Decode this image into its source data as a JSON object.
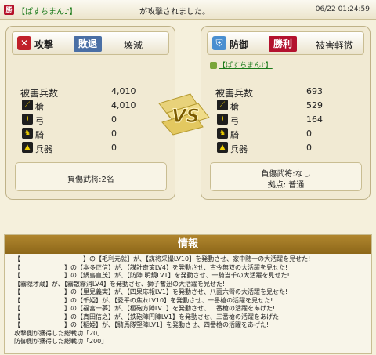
{
  "topbar": {
    "badge": "勝",
    "attacker": "【ぱすちまん♪】",
    "message": "が攻撃されました。",
    "timestamp": "06/22 01:24:59"
  },
  "attacker_panel": {
    "role": "攻撃",
    "result": "敗退",
    "status": "壊滅",
    "total_label": "被害兵数",
    "total_value": "4,010",
    "units": [
      {
        "label": "槍",
        "value": "4,010",
        "icon": "spear-icon"
      },
      {
        "label": "弓",
        "value": "0",
        "icon": "bow-icon"
      },
      {
        "label": "騎",
        "value": "0",
        "icon": "horse-icon"
      },
      {
        "label": "兵器",
        "value": "0",
        "icon": "siege-icon"
      }
    ],
    "footer_line1": "負傷武将:2名"
  },
  "defender_panel": {
    "role": "防御",
    "result": "勝利",
    "status": "被害軽微",
    "hero": "【ぱすちまん♪】",
    "total_label": "被害兵数",
    "total_value": "693",
    "units": [
      {
        "label": "槍",
        "value": "529",
        "icon": "spear-icon"
      },
      {
        "label": "弓",
        "value": "164",
        "icon": "bow-icon"
      },
      {
        "label": "騎",
        "value": "0",
        "icon": "horse-icon"
      },
      {
        "label": "兵器",
        "value": "0",
        "icon": "siege-icon"
      }
    ],
    "footer_line1": "負傷武将:なし",
    "footer_line2": "拠点: 普通"
  },
  "vs_label": "VS",
  "info": {
    "title": "情報",
    "lines": [
      "【　　　　　　　　　　】の【毛利元就】が、【謀将采撮LV10】を発動させ、家中随一の大活躍を見せた!",
      "【　　　　　　　】の【本多正信】が、【謀計奇策LV4】を発動させ、古今無双の大活躍を見せた!",
      "【　　　　　　　】の【鍋島直茂】が、【防陣 明鏡LV1】を発動させ、一騎当千の大活躍を見せた!",
      "【霧隠才蔵】が、【霧散霧消LV4】を発動させ、獅子奮迅の大活躍を見せた!",
      "【　　　　　　　】の【里見義実】が、【四果応報LV1】を発動させ、八面六臂の大活躍を見せた!",
      "【　　　　　　　】の【千姫】が、【愛平の焦れLV10】を発動させ、一番槍の活躍を見せた!",
      "【　　　　　　　】の【福富一夢】が、【極砲方陣LV1】を発動させ、二番槍の活躍をあげた!",
      "【　　　　　　　】の【真田信之】が、【鉄砲陣円陣LV1】を発動させ、三番槍の活躍をあげた!",
      "【　　　　　　　】の【稲姫】が、【騎馬隊堅陣LV1】を発動させ、四番槍の活躍をあげた!",
      "攻撃側が獲得した総戦功「20」",
      "防御側が獲得した総戦功「200」"
    ]
  },
  "colors": {
    "attack_icon": "#c0202a",
    "result_defeat": "#4a6fa5",
    "result_victory": "#b3122e",
    "defend_icon": "#4a8fd0",
    "hero_link": "#1a7a1a",
    "info_header": "#9a7322"
  }
}
